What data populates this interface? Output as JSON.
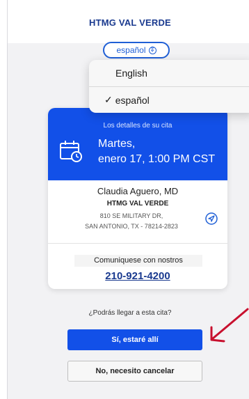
{
  "header": {
    "brand": "HTMG VAL VERDE"
  },
  "language": {
    "current": "español",
    "options": [
      {
        "label": "English",
        "selected": false
      },
      {
        "label": "español",
        "selected": true
      }
    ],
    "check_mark": "✓"
  },
  "appointment": {
    "subtitle": "Los detalles de su cita",
    "day": "Martes,",
    "datetime": "enero 17, 1:00 PM CST",
    "doctor": "Claudia Aguero, MD",
    "clinic": "HTMG VAL VERDE",
    "address_line1": "810 SE MILITARY DR,",
    "address_line2": "SAN ANTONIO, TX - 78214-2823",
    "contact_label": "Comuniquese con nostros",
    "phone": "210-921-4200"
  },
  "confirm": {
    "question": "¿Podrás llegar a esta cita?",
    "yes_label": "Sí, estaré allí",
    "no_label": "No, necesito cancelar"
  },
  "colors": {
    "primary": "#1250e8",
    "brand_text": "#1a3a8f",
    "annotation_arrow": "#c8102e"
  },
  "icons": [
    "calendar-icon",
    "navigation-icon",
    "chevron-updown-icon",
    "annotation-arrow"
  ]
}
